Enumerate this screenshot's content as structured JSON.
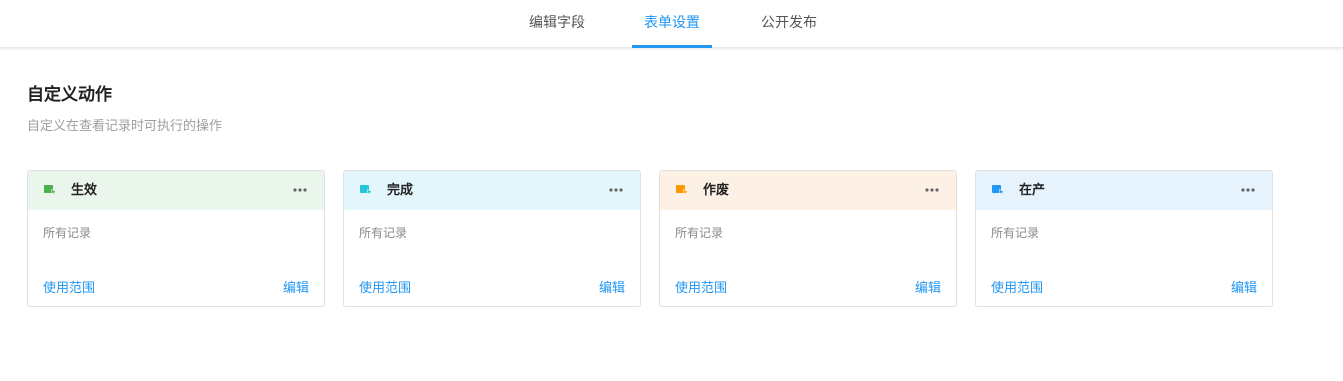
{
  "tabs": [
    {
      "label": "编辑字段",
      "active": false
    },
    {
      "label": "表单设置",
      "active": true
    },
    {
      "label": "公开发布",
      "active": false
    }
  ],
  "section": {
    "title": "自定义动作",
    "description": "自定义在查看记录时可执行的操作"
  },
  "cards": [
    {
      "name": "生效",
      "accent": "#4caf50",
      "header_bg": "#eaf5ec",
      "icon": "cursor-action-icon",
      "record_scope": "所有记录",
      "scope_label": "使用范围",
      "edit_label": "编辑"
    },
    {
      "name": "完成",
      "accent": "#26c6da",
      "header_bg": "#e3f6fb",
      "icon": "cursor-action-icon",
      "record_scope": "所有记录",
      "scope_label": "使用范围",
      "edit_label": "编辑"
    },
    {
      "name": "作废",
      "accent": "#ff9800",
      "header_bg": "#fdf1e6",
      "icon": "cursor-action-icon",
      "record_scope": "所有记录",
      "scope_label": "使用范围",
      "edit_label": "编辑"
    },
    {
      "name": "在产",
      "accent": "#2196f3",
      "header_bg": "#e6f3fd",
      "icon": "cursor-action-icon",
      "record_scope": "所有记录",
      "scope_label": "使用范围",
      "edit_label": "编辑"
    }
  ],
  "colors": {
    "primary": "#2196f3",
    "muted_text": "#9e9e9e"
  }
}
